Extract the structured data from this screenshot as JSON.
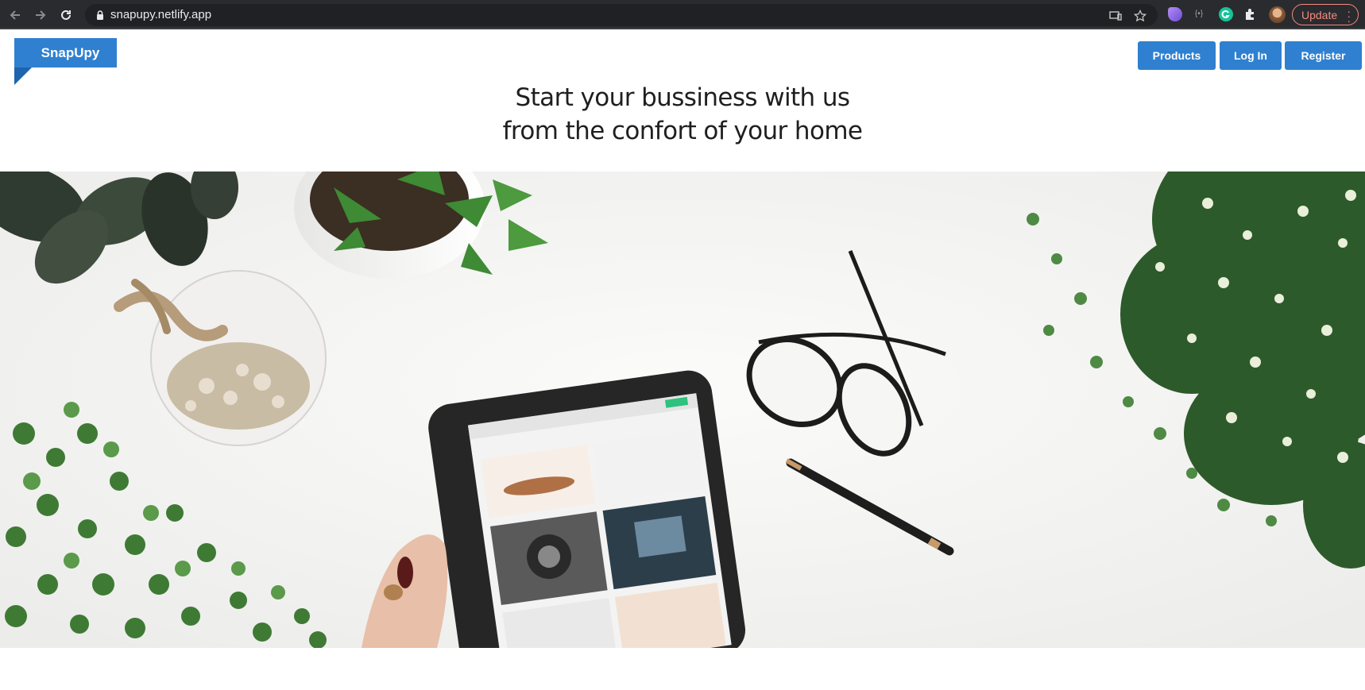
{
  "browser": {
    "url": "snapupy.netlify.app",
    "update_label": "Update"
  },
  "site": {
    "logo_text": "SnapUpy",
    "colors": {
      "primary": "#2f80d0",
      "primary_dark": "#1d65ad"
    },
    "nav": {
      "products_label": "Products",
      "login_label": "Log In",
      "register_label": "Register"
    },
    "hero": {
      "line1": "Start your bussiness with us",
      "line2": "from the confort of your home"
    }
  }
}
